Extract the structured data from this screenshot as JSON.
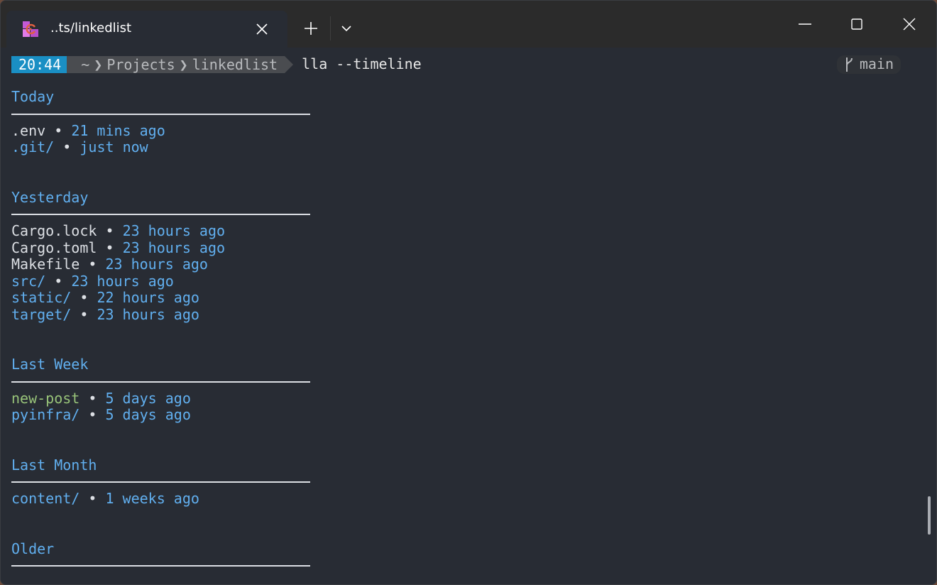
{
  "window": {
    "tab_title": "..ts/linkedlist",
    "tab_icon": "terminal-app-icon",
    "controls": [
      "minimize",
      "maximize",
      "close"
    ]
  },
  "prompt": {
    "time": "20:44",
    "path": [
      "~",
      "Projects",
      "linkedlist"
    ],
    "command": "lla --timeline",
    "git_branch": "main",
    "colors": {
      "time_bg": "#1a8fc4",
      "path_bg": "#4a4c50"
    }
  },
  "timeline": [
    {
      "title": "Today",
      "entries": [
        {
          "name": ".env",
          "kind": "file",
          "time": "21 mins ago"
        },
        {
          "name": ".git/",
          "kind": "dir",
          "time": "just now"
        }
      ]
    },
    {
      "title": "Yesterday",
      "entries": [
        {
          "name": "Cargo.lock",
          "kind": "file",
          "time": "23 hours ago"
        },
        {
          "name": "Cargo.toml",
          "kind": "file",
          "time": "23 hours ago"
        },
        {
          "name": "Makefile",
          "kind": "file",
          "time": "23 hours ago"
        },
        {
          "name": "src/",
          "kind": "dir",
          "time": "23 hours ago"
        },
        {
          "name": "static/",
          "kind": "dir",
          "time": "22 hours ago"
        },
        {
          "name": "target/",
          "kind": "dir",
          "time": "23 hours ago"
        }
      ]
    },
    {
      "title": "Last Week",
      "entries": [
        {
          "name": "new-post",
          "kind": "green",
          "time": "5 days ago"
        },
        {
          "name": "pyinfra/",
          "kind": "dir",
          "time": "5 days ago"
        }
      ]
    },
    {
      "title": "Last Month",
      "entries": [
        {
          "name": "content/",
          "kind": "dir",
          "time": "1 weeks ago"
        }
      ]
    },
    {
      "title": "Older",
      "entries": []
    }
  ],
  "bullet": "•"
}
